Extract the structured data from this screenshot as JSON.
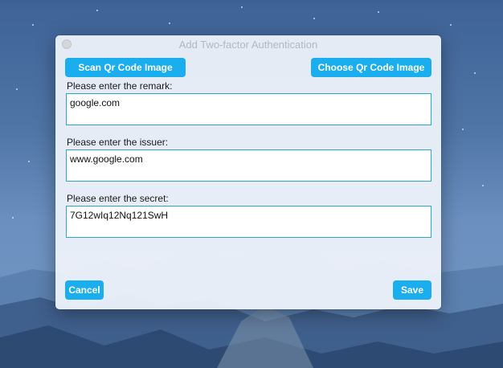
{
  "window": {
    "title": "Add Two-factor Authentication"
  },
  "toolbar": {
    "scan_label": "Scan Qr Code Image",
    "choose_label": "Choose Qr Code Image"
  },
  "form": {
    "remark_label": "Please enter the remark:",
    "remark_value": "google.com",
    "issuer_label": "Please enter the issuer:",
    "issuer_value": "www.google.com",
    "secret_label": "Please enter the secret:",
    "secret_value": "7G12wIq12Nq121SwH"
  },
  "footer": {
    "cancel_label": "Cancel",
    "save_label": "Save"
  },
  "colors": {
    "accent": "#1aaeee",
    "field_border": "#2aa7c9",
    "window_bg": "#eef2fa"
  }
}
